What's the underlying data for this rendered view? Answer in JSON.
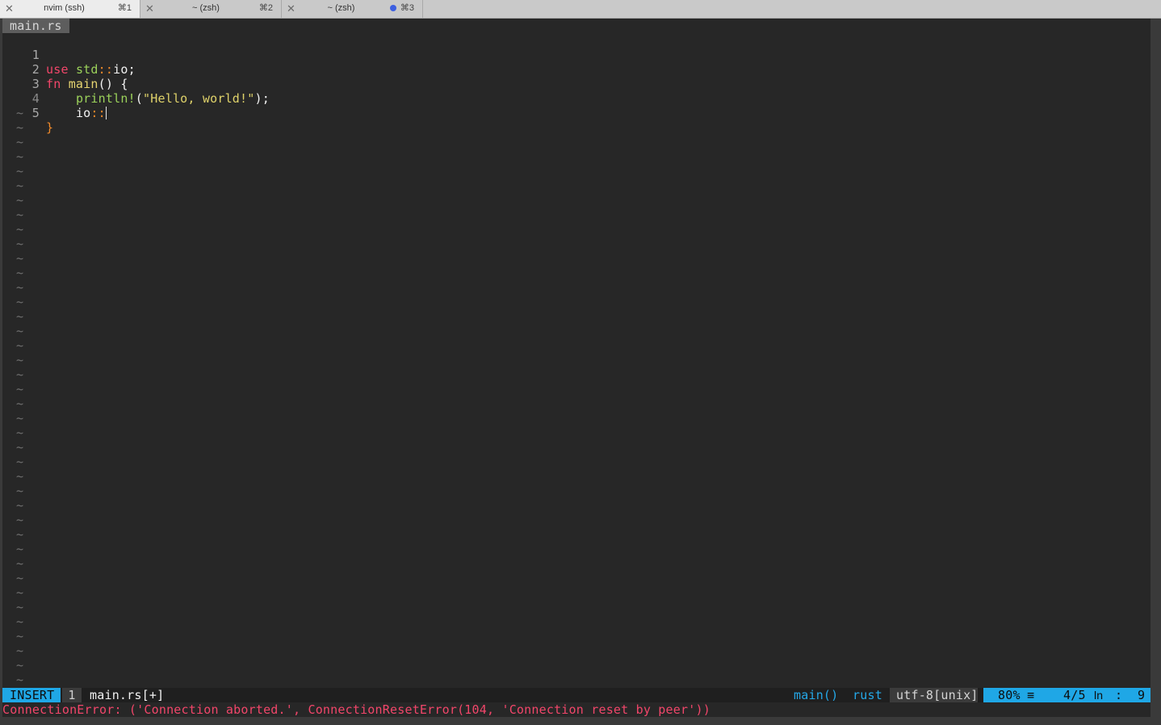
{
  "tabs": [
    {
      "label": "nvim (ssh)",
      "shortcut": "⌘1",
      "active": true
    },
    {
      "label": "~ (zsh)",
      "shortcut": "⌘2",
      "active": false
    },
    {
      "label": "~ (zsh)",
      "shortcut": "⌘3",
      "active": false,
      "activity_dot": true
    }
  ],
  "buffer_tab": "main.rs",
  "line_numbers": [
    "1",
    "2",
    "3",
    "4",
    "5"
  ],
  "code": {
    "l1": {
      "kw": "use",
      "ty": "std",
      "sep": "::",
      "rest": "io;"
    },
    "l2": {
      "kw": "fn",
      "name": "main",
      "rest": "() {"
    },
    "l3": {
      "indent": "    ",
      "macro": "println!",
      "open": "(",
      "str": "\"Hello, world!\"",
      "close": ");"
    },
    "l4": {
      "indent": "    ",
      "ident": "io",
      "sep": "::"
    },
    "l5": {
      "brace": "}"
    }
  },
  "tilde": "~",
  "statusline": {
    "mode": "INSERT",
    "buffer_number": "1",
    "filename": "main.rs[+]",
    "function": "main()",
    "filetype": "rust",
    "encoding": "utf-8[unix]",
    "percent": "80%",
    "percent_icon": "≡",
    "line_pos": "4/5",
    "ln_label": "ln",
    "col_sep": ":",
    "column": "9"
  },
  "message": "ConnectionError: ('Connection aborted.', ConnectionResetError(104, 'Connection reset by peer'))",
  "colors": {
    "background": "#272727",
    "keyword": "#f2466a",
    "type": "#9bd15a",
    "function": "#e6d470",
    "operator": "#f08a2a",
    "mode_accent": "#1fa7e6",
    "error": "#f2466a"
  }
}
